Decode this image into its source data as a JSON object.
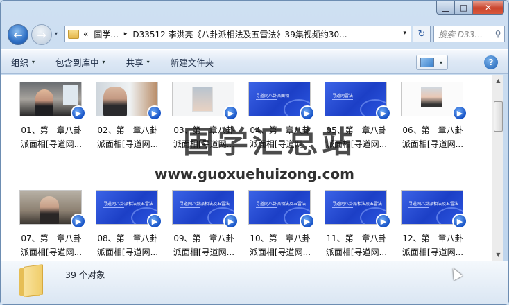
{
  "window": {
    "minimize_glyph": "▁",
    "maximize_glyph": "□",
    "close_glyph": "✕"
  },
  "nav": {
    "back_glyph": "←",
    "forward_glyph": "→",
    "history_glyph": "▾",
    "breadcrumb": [
      {
        "label": "«"
      },
      {
        "label": "国学..."
      },
      {
        "label": "D33512 李洪亮《八卦派相法及五雷法》39集视频约30..."
      }
    ],
    "crumb_separator": "▸",
    "address_dropdown_glyph": "▾",
    "refresh_glyph": "↻",
    "search_placeholder": "搜索 D33...",
    "search_icon_glyph": "⚲"
  },
  "toolbar": {
    "organize": "组织",
    "include_in_library": "包含到库中",
    "share": "共享",
    "new_folder": "新建文件夹",
    "caret": "▾",
    "help": "?"
  },
  "files": [
    {
      "line1": "01、第一章八卦",
      "line2": "派面相[寻道网...",
      "thumb": "photo"
    },
    {
      "line1": "02、第一章八卦",
      "line2": "派面相[寻道网...",
      "thumb": "photo2"
    },
    {
      "line1": "03、第一章八卦",
      "line2": "派面相[寻道网...",
      "thumb": "photo3"
    },
    {
      "line1": "04、第一章八卦",
      "line2": "派面相[寻道网...",
      "thumb": "slide",
      "slide_title": "寻道网八卦派面相"
    },
    {
      "line1": "05、第一章八卦",
      "line2": "派面相[寻道网...",
      "thumb": "slide",
      "slide_title": "寻道网雷法"
    },
    {
      "line1": "06、第一章八卦",
      "line2": "派面相[寻道网...",
      "thumb": "photo4"
    },
    {
      "line1": "07、第一章八卦",
      "line2": "派面相[寻道网...",
      "thumb": "photo5"
    },
    {
      "line1": "08、第一章八卦",
      "line2": "派面相[寻道网...",
      "thumb": "slide",
      "slide_title": "寻道网八卦派相法及五雷法"
    },
    {
      "line1": "09、第一章八卦",
      "line2": "派面相[寻道网...",
      "thumb": "slide",
      "slide_title": "寻道网八卦派相法及五雷法"
    },
    {
      "line1": "10、第一章八卦",
      "line2": "派面相[寻道网...",
      "thumb": "slide",
      "slide_title": "寻道网八卦派相法及五雷法"
    },
    {
      "line1": "11、第一章八卦",
      "line2": "派面相[寻道网...",
      "thumb": "slide",
      "slide_title": "寻道网八卦派相法及五雷法"
    },
    {
      "line1": "12、第一章八卦",
      "line2": "派面相[寻道网...",
      "thumb": "slide",
      "slide_title": "寻道网八卦派相法及五雷法"
    }
  ],
  "video_badge_glyph": "▶",
  "watermark": {
    "title": "国学汇总站",
    "url": "www.guoxuehuizong.com"
  },
  "scrollbar": {
    "up_glyph": "▲",
    "down_glyph": "▼"
  },
  "details": {
    "count": "39 个对象"
  },
  "colors": {
    "slide_blue": "#1c3fc6",
    "badge_blue": "#1652c6",
    "close_red": "#c9452d"
  }
}
